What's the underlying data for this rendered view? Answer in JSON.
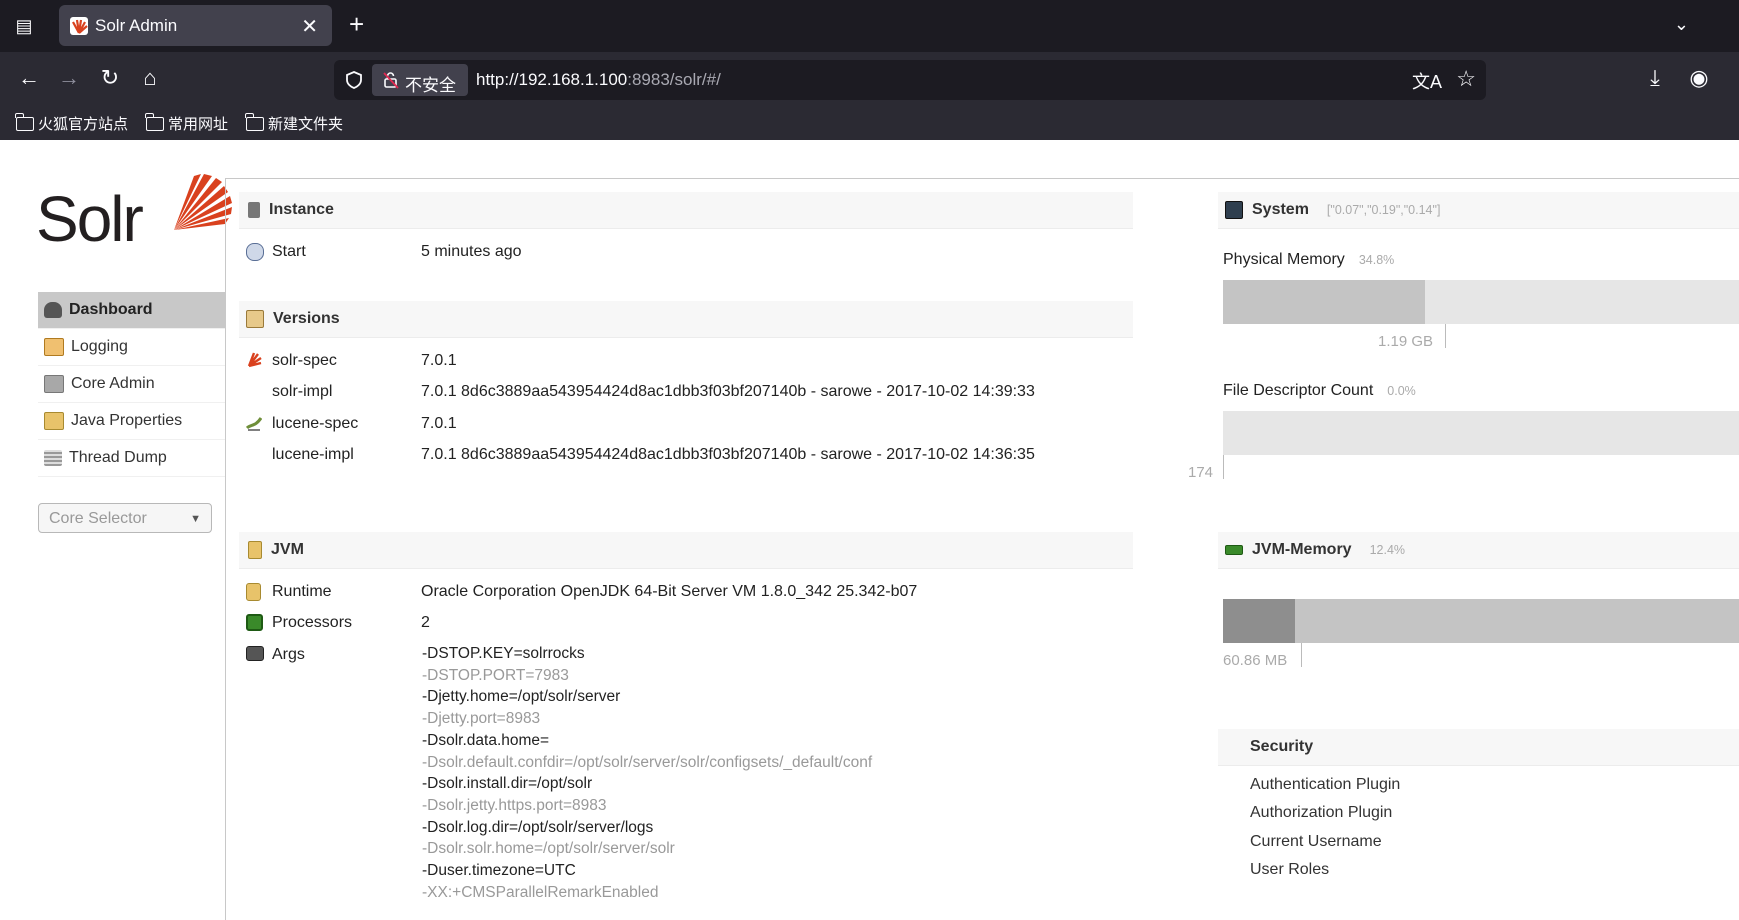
{
  "browser": {
    "tab_title": "Solr Admin",
    "url_host": "http://192.168.1.100",
    "url_rest": ":8983/solr/#/",
    "security_label": "不安全",
    "bookmarks": [
      "火狐官方站点",
      "常用网址",
      "新建文件夹"
    ]
  },
  "logo_text": "Solr",
  "menu": [
    {
      "label": "Dashboard",
      "icon": "dashboard-icon"
    },
    {
      "label": "Logging",
      "icon": "logging-icon"
    },
    {
      "label": "Core Admin",
      "icon": "core-admin-icon"
    },
    {
      "label": "Java Properties",
      "icon": "java-properties-icon"
    },
    {
      "label": "Thread Dump",
      "icon": "thread-dump-icon"
    }
  ],
  "core_selector": "Core Selector",
  "instance": {
    "title": "Instance",
    "start_label": "Start",
    "start_value": "5 minutes ago"
  },
  "versions": {
    "title": "Versions",
    "rows": [
      {
        "key": "solr-spec",
        "value": "7.0.1"
      },
      {
        "key": "solr-impl",
        "value": "7.0.1 8d6c3889aa543954424d8ac1dbb3f03bf207140b - sarowe - 2017-10-02 14:39:33"
      },
      {
        "key": "lucene-spec",
        "value": "7.0.1"
      },
      {
        "key": "lucene-impl",
        "value": "7.0.1 8d6c3889aa543954424d8ac1dbb3f03bf207140b - sarowe - 2017-10-02 14:36:35"
      }
    ]
  },
  "jvm": {
    "title": "JVM",
    "runtime_label": "Runtime",
    "runtime_value": "Oracle Corporation OpenJDK 64-Bit Server VM 1.8.0_342 25.342-b07",
    "processors_label": "Processors",
    "processors_value": "2",
    "args_label": "Args",
    "args": [
      "-DSTOP.KEY=solrrocks",
      "-DSTOP.PORT=7983",
      "-Djetty.home=/opt/solr/server",
      "-Djetty.port=8983",
      "-Dsolr.data.home=",
      "-Dsolr.default.confdir=/opt/solr/server/solr/configsets/_default/conf",
      "-Dsolr.install.dir=/opt/solr",
      "-Dsolr.jetty.https.port=8983",
      "-Dsolr.log.dir=/opt/solr/server/logs",
      "-Dsolr.solr.home=/opt/solr/server/solr",
      "-Duser.timezone=UTC",
      "-XX:+CMSParallelRemarkEnabled"
    ]
  },
  "system": {
    "title": "System",
    "load": "[\"0.07\",\"0.19\",\"0.14\"]",
    "physical_memory_label": "Physical Memory",
    "physical_memory_pct": "34.8%",
    "physical_memory_fraction": 0.348,
    "physical_memory_value": "1.19 GB",
    "fd_label": "File Descriptor Count",
    "fd_pct": "0.0%",
    "fd_value": "174"
  },
  "jvm_memory": {
    "title": "JVM-Memory",
    "pct": "12.4%",
    "used_fraction": 0.124,
    "value": "60.86 MB"
  },
  "security": {
    "title": "Security",
    "items": [
      "Authentication Plugin",
      "Authorization Plugin",
      "Current Username",
      "User Roles"
    ]
  },
  "colors": {
    "solr_orange": "#d9411e",
    "chrome_dark": "#1c1b22",
    "chrome_mid": "#2b2a33"
  }
}
